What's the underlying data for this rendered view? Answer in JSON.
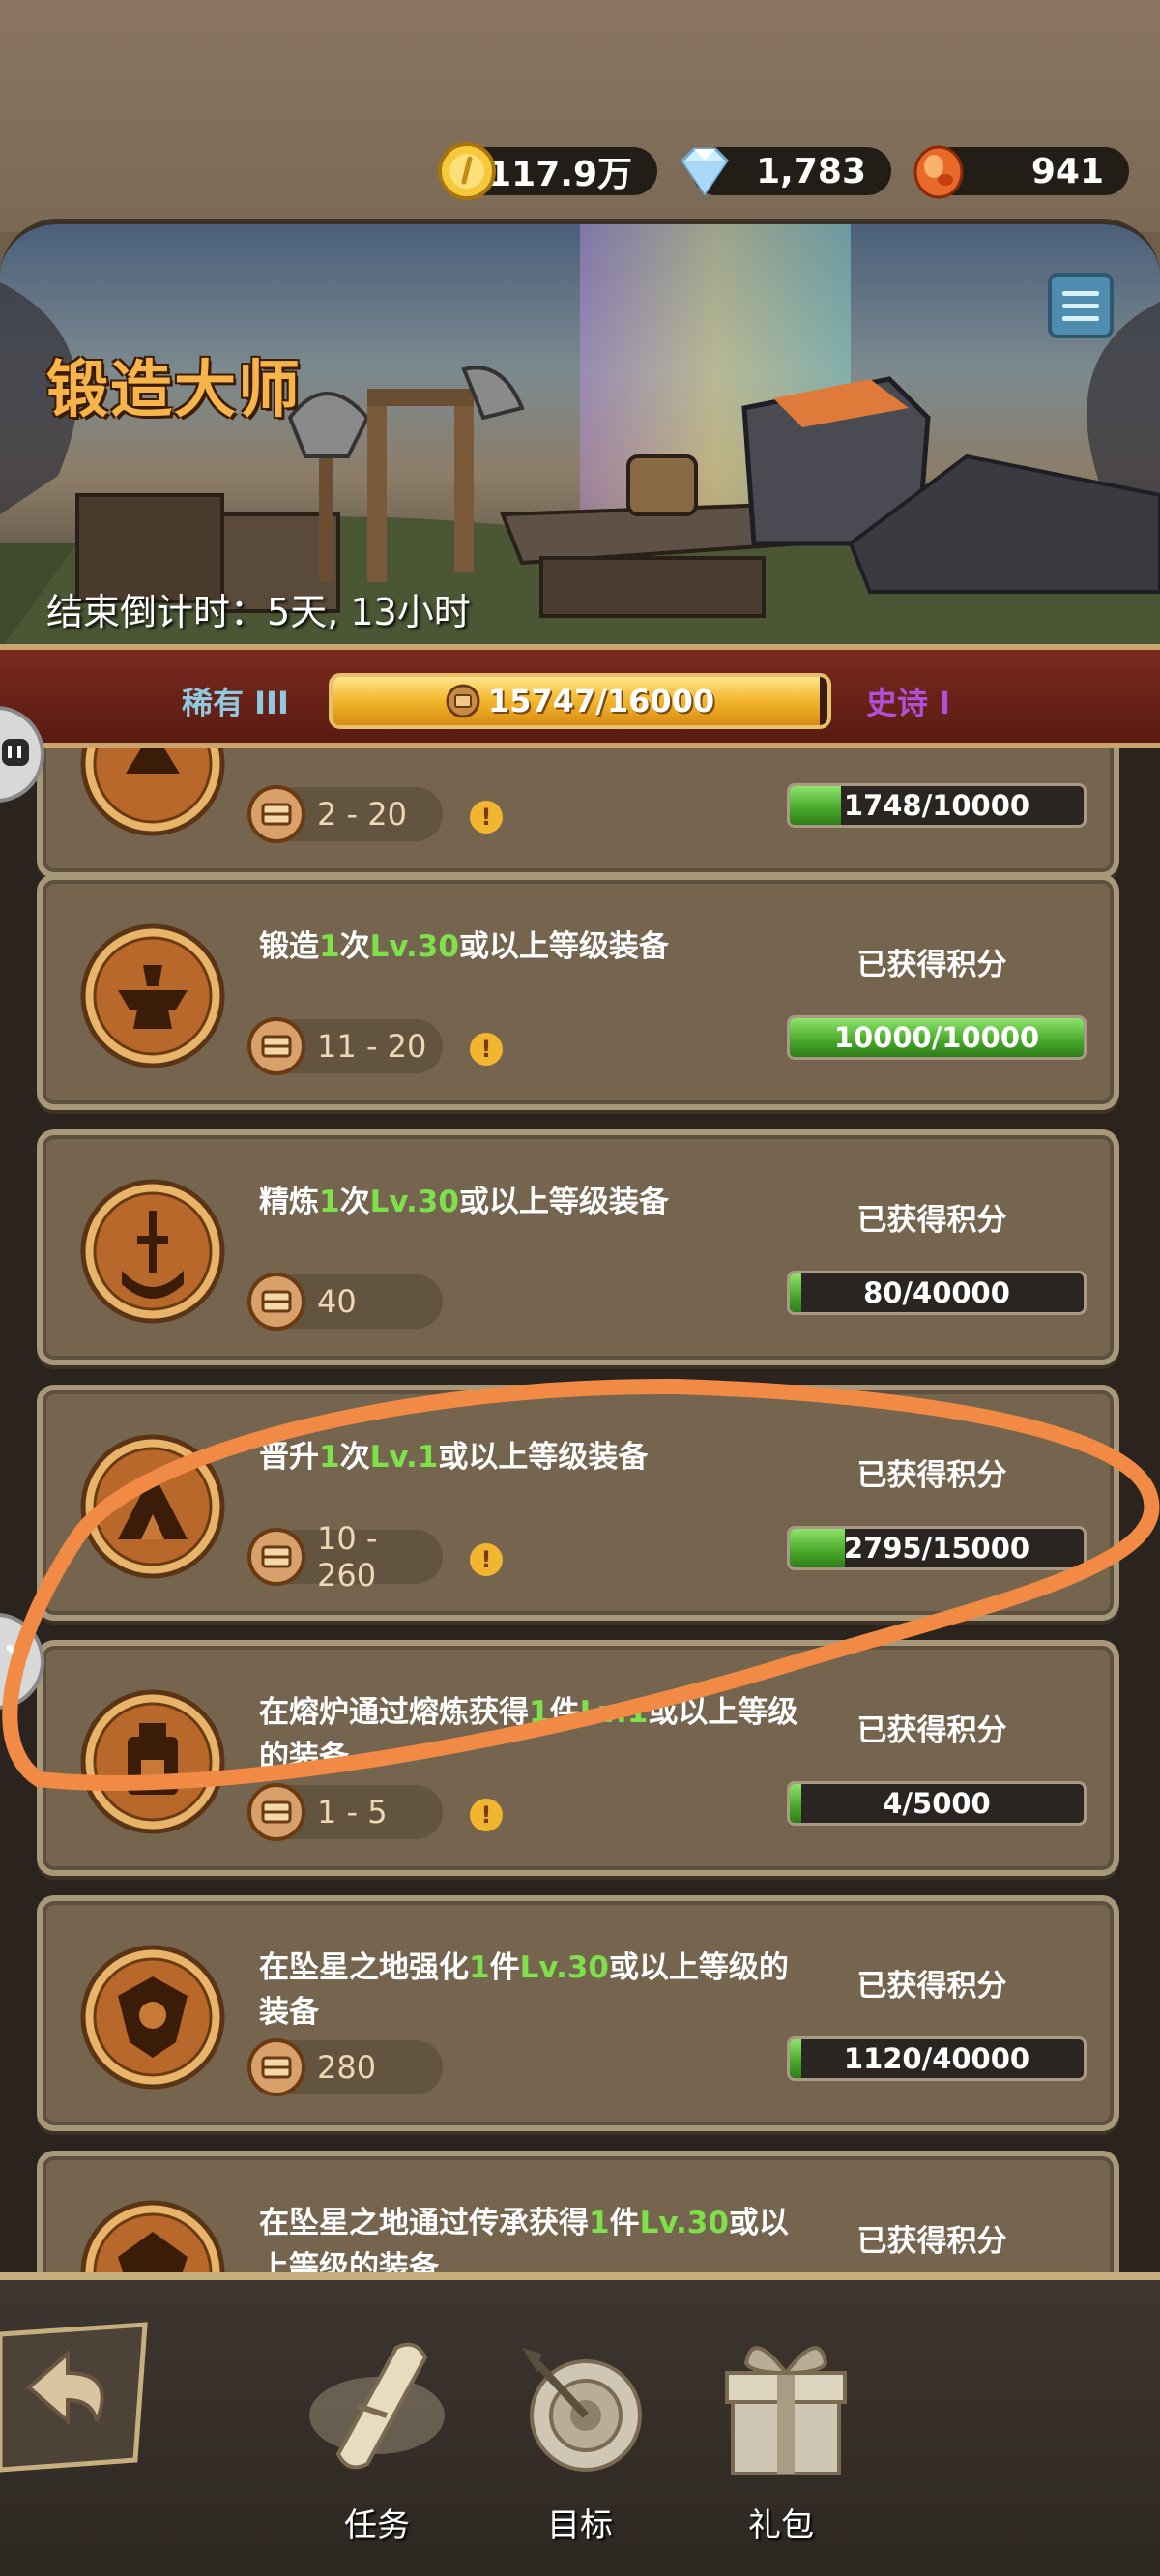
{
  "currencies": [
    {
      "name": "gold-coin",
      "value": "117.9万",
      "color": "#f5c93a"
    },
    {
      "name": "diamond",
      "value": "1,783",
      "color": "#bfe6ff"
    },
    {
      "name": "fire-gem",
      "value": "941",
      "color": "#e8692a"
    }
  ],
  "banner": {
    "title": "锻造大师",
    "countdown_label": "结束倒计时：",
    "countdown_value": "5天, 13小时"
  },
  "rank": {
    "current": "稀有 III",
    "next": "史诗 I",
    "progress_text": "15747/16000",
    "progress": 0.984
  },
  "tasks": [
    {
      "title_parts": [
        "",
        "",
        "",
        "",
        ""
      ],
      "reward": "2 - 20",
      "has_info": true,
      "progress_label": "",
      "progress_text": "1748/10000",
      "progress": 0.1748,
      "icon": "forge-icon"
    },
    {
      "title_parts": [
        "锻造",
        "1",
        "次",
        "Lv.30",
        "或以上等级装备"
      ],
      "reward": "11 - 20",
      "has_info": true,
      "progress_label": "已获得积分",
      "progress_text": "10000/10000",
      "progress": 1.0,
      "icon": "anvil-icon"
    },
    {
      "title_parts": [
        "精炼",
        "1",
        "次",
        "Lv.30",
        "或以上等级装备"
      ],
      "reward": "40",
      "has_info": false,
      "progress_label": "已获得积分",
      "progress_text": "80/40000",
      "progress": 0.002,
      "icon": "sword-icon"
    },
    {
      "title_parts": [
        "晋升",
        "1",
        "次",
        "Lv.1",
        "或以上等级装备"
      ],
      "reward": "10 - 260",
      "has_info": true,
      "progress_label": "已获得积分",
      "progress_text": "2795/15000",
      "progress": 0.1863,
      "icon": "tent-icon"
    },
    {
      "title_parts": [
        "在熔炉通过熔炼获得",
        "1",
        "件",
        "Lv.1",
        "或以上等级的装备"
      ],
      "reward": "1 - 5",
      "has_info": true,
      "progress_label": "已获得积分",
      "progress_text": "4/5000",
      "progress": 0.0008,
      "icon": "furnace-icon"
    },
    {
      "title_parts": [
        "在坠星之地强化",
        "1",
        "件",
        "Lv.30",
        "或以上等级的装备"
      ],
      "reward": "280",
      "has_info": false,
      "progress_label": "已获得积分",
      "progress_text": "1120/40000",
      "progress": 0.028,
      "icon": "shield-icon"
    },
    {
      "title_parts": [
        "在坠星之地通过传承获得",
        "1",
        "件",
        "Lv.30",
        "或以上等级的装备"
      ],
      "reward": "",
      "has_info": false,
      "progress_label": "已获得积分",
      "progress_text": "",
      "progress": 0,
      "icon": "crest-icon"
    }
  ],
  "nav": {
    "tasks_label": "任务",
    "goals_label": "目标",
    "gifts_label": "礼包"
  },
  "colors": {
    "highlight_green": "#7ee04a",
    "annotation_orange": "#f08a44"
  }
}
